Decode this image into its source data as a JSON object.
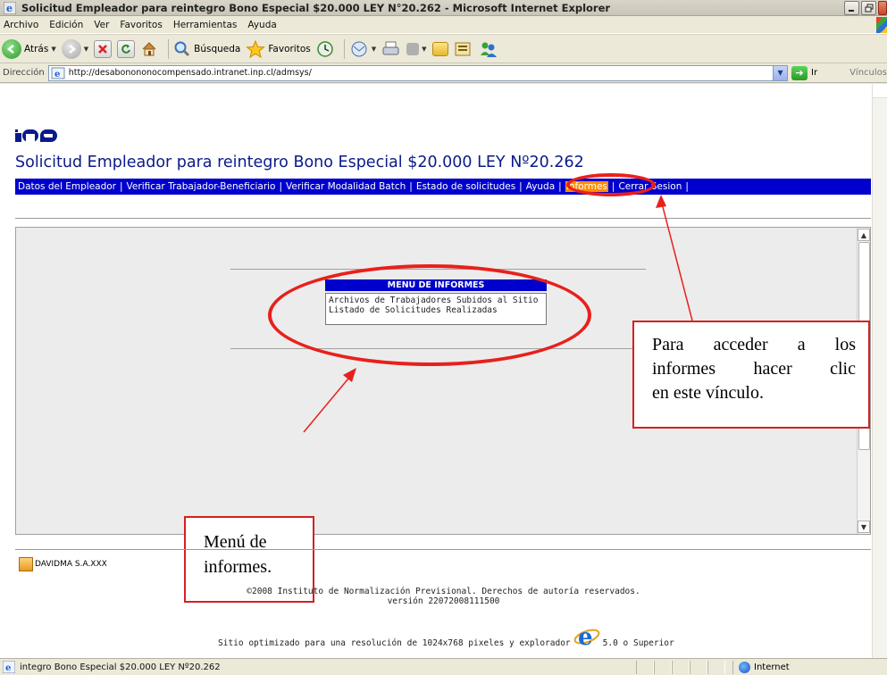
{
  "window": {
    "title": "Solicitud Empleador para reintegro Bono Especial $20.000 LEY N°20.262 - Microsoft Internet Explorer"
  },
  "menubar": [
    "Archivo",
    "Edición",
    "Ver",
    "Favoritos",
    "Herramientas",
    "Ayuda"
  ],
  "toolbar": {
    "back_label": "Atrás",
    "search_label": "Búsqueda",
    "favorites_label": "Favoritos"
  },
  "address": {
    "label": "Dirección",
    "url": "http://desabonononocompensado.intranet.inp.cl/admsys/",
    "go_label": "Ir",
    "links_label": "Vínculos"
  },
  "page": {
    "logo_text": "INP",
    "title": "Solicitud Empleador para reintegro Bono Especial $20.000 LEY Nº20.262",
    "nav": [
      {
        "label": "Datos del Empleador"
      },
      {
        "label": "Verificar Trabajador-Beneficiario"
      },
      {
        "label": "Verificar Modalidad Batch"
      },
      {
        "label": "Estado de solicitudes"
      },
      {
        "label": "Ayuda"
      },
      {
        "label": "Informes"
      },
      {
        "label": "Cerrar Sesion"
      }
    ],
    "report_menu": {
      "header": "MENU DE INFORMES",
      "items": [
        "Archivos de Trabajadores Subidos al Sitio",
        "Listado de Solicitudes Realizadas"
      ]
    },
    "callout_informes": [
      "Para acceder a los",
      "informes hacer clic",
      "en este vínculo."
    ],
    "callout_menu": [
      "Menú de",
      "informes."
    ],
    "user": "DAVIDMA S.A.XXX",
    "copyright": "©2008 Instituto de Normalización Previsional. Derechos de autoría reservados.",
    "version": "versión 22072008111500",
    "optimized_pre": "Sitio optimizado para una resolución de 1024x768 pixeles y explorador",
    "optimized_post": "5.0 o Superior"
  },
  "status": {
    "text": "integro Bono Especial $20.000 LEY Nº20.262",
    "zone": "Internet"
  },
  "colors": {
    "nav_bg": "#0000cd",
    "nav_active": "#ff8c00",
    "title_color": "#0a1a8a",
    "annotation_red": "#e8201c"
  }
}
